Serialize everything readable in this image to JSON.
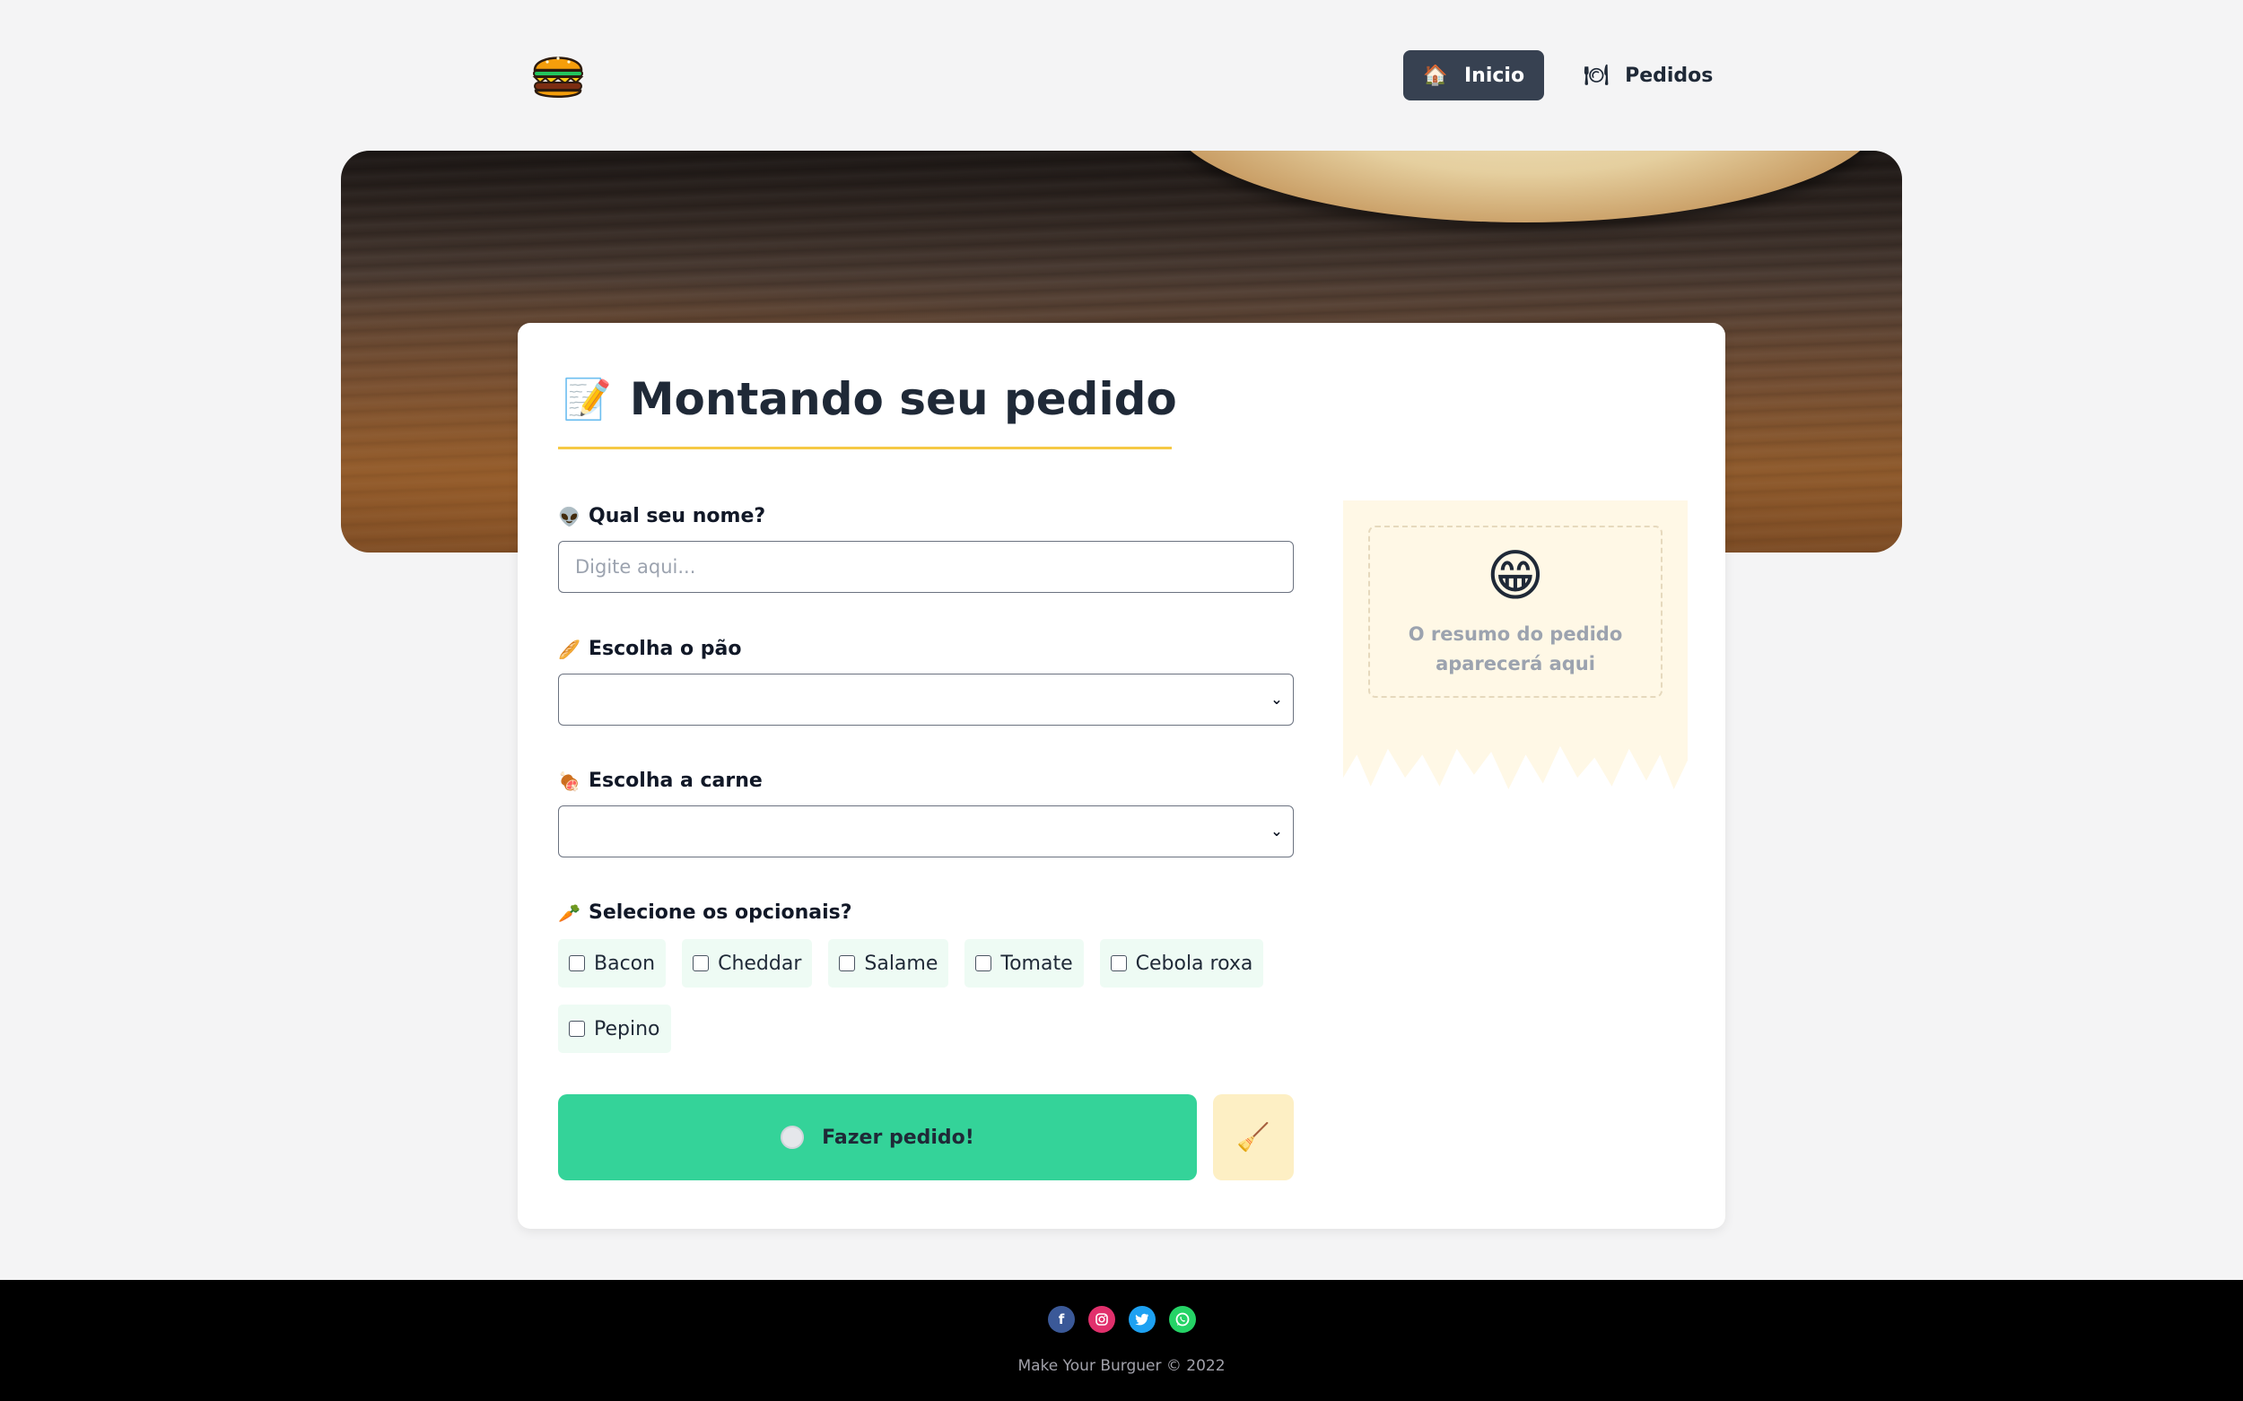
{
  "header": {
    "logo_icon": "burger-icon",
    "nav": [
      {
        "label": "Inicio",
        "icon": "house-icon",
        "active": true
      },
      {
        "label": "Pedidos",
        "icon": "plate-icon",
        "active": false
      }
    ]
  },
  "form": {
    "title": "Montando seu pedido",
    "title_icon": "memo-icon",
    "name_field": {
      "label": "Qual seu nome?",
      "placeholder": "Digite aqui...",
      "value": ""
    },
    "bread_field": {
      "label": "Escolha o pão",
      "value": ""
    },
    "meat_field": {
      "label": "Escolha a carne",
      "value": ""
    },
    "optionals_label": "Selecione os opcionais?",
    "optionals": [
      "Bacon",
      "Cheddar",
      "Salame",
      "Tomate",
      "Cebola roxa",
      "Pepino"
    ],
    "submit_label": "Fazer pedido!",
    "clear_icon": "broom-icon"
  },
  "summary": {
    "icon": "grinning-face-icon",
    "text": "O resumo do pedido aparecerá aqui"
  },
  "footer": {
    "socials": [
      "facebook-icon",
      "instagram-icon",
      "twitter-icon",
      "whatsapp-icon"
    ],
    "copyright": "Make Your Burguer © 2022"
  },
  "colors": {
    "accent_green": "#34d399",
    "nav_active": "#374151",
    "title_underline": "#f6c945",
    "summary_bg": "#fff8e6",
    "clear_button": "#fdefc4"
  }
}
